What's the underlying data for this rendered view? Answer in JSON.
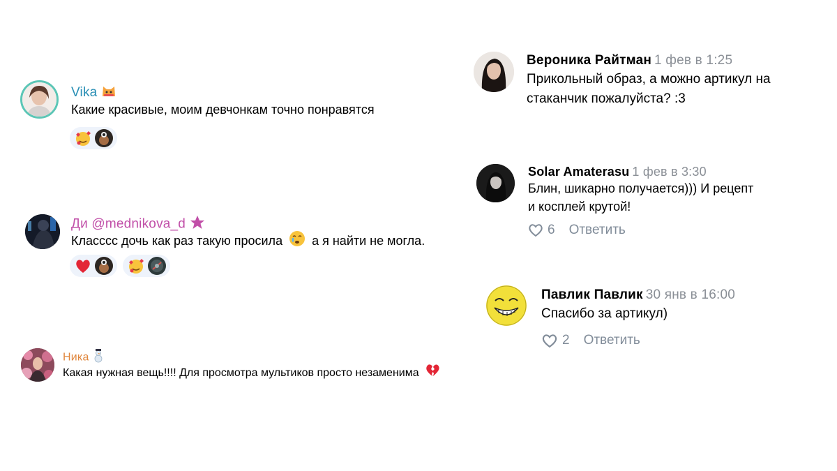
{
  "left_comments": [
    {
      "name": "Vika",
      "name_color": "#2a8fb5",
      "text": "Какие красивые, моим девчонкам точно понравятся"
    },
    {
      "name": "Ди @mednikova_d",
      "name_color": "#c14fa8",
      "text": "Класссс дочь как раз такую просила",
      "text_tail": "а я найти не могла."
    },
    {
      "name": "Ника",
      "name_color": "#e0873e",
      "text": "Какая нужная вещь!!!! Для просмотра мультиков просто незаменима"
    }
  ],
  "right_comments": [
    {
      "name": "Вероника Райтман",
      "date": "1 фев в 1:25",
      "text_lines": [
        "Прикольный образ, а можно артикул на",
        "стаканчик пожалуйста? :3"
      ]
    },
    {
      "name": "Solar Amaterasu",
      "date": "1 фев в 3:30",
      "text_lines": [
        "Блин, шикарно получается))) И рецепт",
        "и косплей крутой!"
      ],
      "likes": "6",
      "reply_label": "Ответить"
    },
    {
      "name": "Павлик Павлик",
      "date": "30 янв в 16:00",
      "text_lines": [
        "Спасибо за артикул)"
      ],
      "likes": "2",
      "reply_label": "Ответить"
    }
  ],
  "icons": {
    "like": "heart-outline-icon",
    "reactions": [
      "smiling-face-with-hearts-icon",
      "avatar-reaction-icon",
      "red-heart-icon",
      "crying-face-icon",
      "broken-heart-icon",
      "snowman-icon",
      "cat-emoji-icon"
    ]
  }
}
